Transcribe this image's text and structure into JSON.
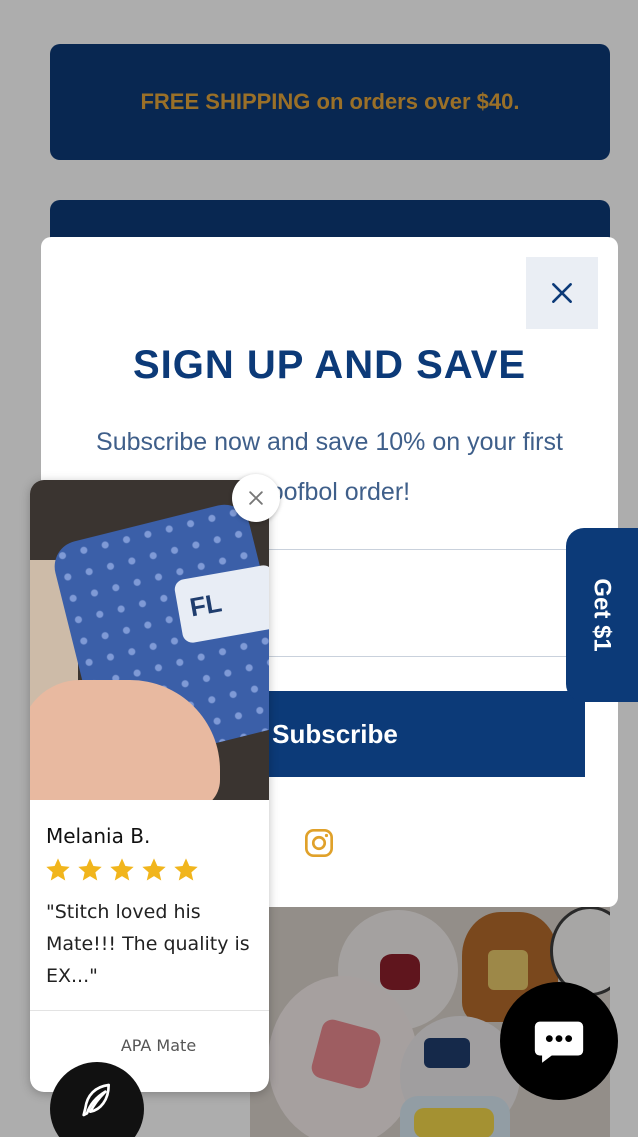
{
  "announcement": {
    "text": "FREE SHIPPING on orders over $40."
  },
  "popup": {
    "title": "SIGN UP AND SAVE",
    "subtitle": "Subscribe now and save 10% on your first Floofbol order!",
    "email_placeholder": "",
    "subscribe_label": "Subscribe",
    "close_icon": "close-icon",
    "social_icon": "instagram-icon"
  },
  "side_tab": {
    "label": "Get $1"
  },
  "review": {
    "reviewer": "Melania B.",
    "rating": 5,
    "rating_max": 5,
    "text": "\"Stitch loved his Mate!!! The quality is EX...\"",
    "product": "APA Mate",
    "close_icon": "close-icon"
  },
  "floating": {
    "loyalty_icon": "feather-icon",
    "chat_icon": "chat-bubble-icon"
  },
  "colors": {
    "brand_navy": "#0c3a78",
    "accent_gold": "#e3a53c",
    "star_gold": "#f1b51c",
    "instagram_gold": "#e0a12a"
  }
}
